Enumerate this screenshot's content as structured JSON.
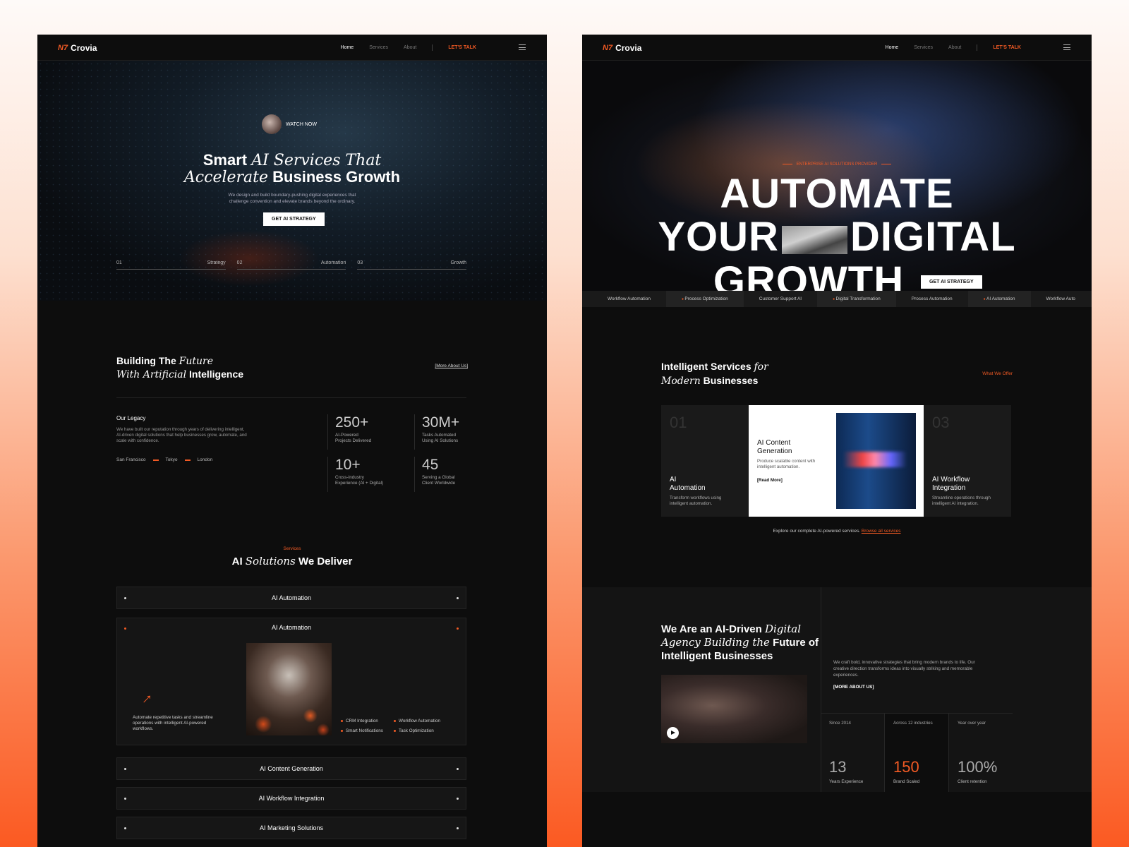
{
  "nav": {
    "logo": "Crovia",
    "logo_mark": "N7",
    "links": [
      "Home",
      "Services",
      "About"
    ],
    "cta": "LET'S TALK"
  },
  "page1": {
    "watch_label": "WATCH NOW",
    "hero": {
      "line1_a": "Smart",
      "line1_b": "AI Services That",
      "line2_a": "Accelerate",
      "line2_b": "Business Growth",
      "subtitle_1": "We design and build boundary-pushing digital experiences that",
      "subtitle_2": "challenge convention and elevate brands beyond the ordinary.",
      "button": "GET AI STRATEGY"
    },
    "steps": [
      {
        "num": "01",
        "label": "Strategy"
      },
      {
        "num": "02",
        "label": "Automation"
      },
      {
        "num": "03",
        "label": "Growth"
      }
    ],
    "about": {
      "title_a": "Building The",
      "title_b": "Future",
      "title_c": "With Artificial",
      "title_d": "Intelligence",
      "link": "[More About Us]",
      "legacy_title": "Our Legacy",
      "legacy_text": "We have built our reputation through years of delivering intelligent, AI-driven digital solutions that help businesses grow, automate, and scale with confidence.",
      "cities": [
        "San Francisco",
        "Tokyo",
        "London"
      ]
    },
    "stats": [
      {
        "num": "250+",
        "l1": "AI-Powered",
        "l2": "Projects Delivered"
      },
      {
        "num": "30M+",
        "l1": "Tasks Automated",
        "l2": "Using AI Solutions"
      },
      {
        "num": "10+",
        "l1": "Cross-Industry",
        "l2": "Experience (AI + Digital)"
      },
      {
        "num": "45",
        "l1": "Serving a Global",
        "l2": "Client Worldwide"
      }
    ],
    "services": {
      "tag": "Services",
      "title_a": "AI",
      "title_b": "Solutions",
      "title_c": "We Deliver",
      "items": [
        "AI Automation",
        "AI Automation",
        "AI Content Generation",
        "AI Workflow Integration",
        "AI Marketing Solutions"
      ],
      "open_desc": "Automate repetitive tasks and streamline operations with intelligent AI-powered workflows.",
      "features": [
        "CRM Integration",
        "Workflow Automation",
        "Smart Notifications",
        "Task Optimization"
      ]
    }
  },
  "page2": {
    "eyebrow": "ENTERPRISE AI SOLUTIONS PROVIDER",
    "hero": {
      "line1": "AUTOMATE",
      "line2_a": "YOUR",
      "line2_b": "DIGITAL",
      "line3": "GROWTH",
      "button": "GET AI STRATEGY"
    },
    "marquee": [
      "Workflow Automation",
      "Process Optimization",
      "Customer Support AI",
      "Digital Transformation",
      "Process Automation",
      "AI Automation",
      "Workflow Auto"
    ],
    "services": {
      "title_a": "Intelligent Services",
      "title_b": "for",
      "title_c": "Modern",
      "title_d": "Businesses",
      "link": "What We Offer",
      "cards": [
        {
          "num": "01",
          "title_1": "AI",
          "title_2": "Automation",
          "desc_1": "Transform workflows using",
          "desc_2": "intelligent automation."
        },
        {
          "title_1": "AI Content",
          "title_2": "Generation",
          "desc_1": "Produce scalable content with",
          "desc_2": "intelligent automation.",
          "link": "[Read More]"
        },
        {
          "num": "03",
          "title_1": "AI Workflow",
          "title_2": "Integration",
          "desc_1": "Streamline operations through",
          "desc_2": "intelligent AI integration."
        }
      ],
      "explore": "Explore our complete AI-powered services.",
      "explore_link": "Browse all services"
    },
    "about": {
      "title_a": "We Are an AI-Driven",
      "title_b": "Digital",
      "title_c": "Agency Building the",
      "title_d": "Future of",
      "title_e": "Intelligent Businesses",
      "text": "We craft bold, innovative strategies that bring modern brands to life. Our creative direction transforms ideas into visually striking and memorable experiences.",
      "link": "[MORE ABOUT US]",
      "stats": [
        {
          "label": "Since 2014",
          "num": "13",
          "sub": "Years Experience"
        },
        {
          "label": "Across 12 industries",
          "num": "150",
          "sub": "Brand Scaled"
        },
        {
          "label": "Year over year",
          "num": "100%",
          "sub": "Client retention"
        }
      ]
    }
  },
  "colors": {
    "accent": "#f25a24",
    "panel_bg": "#0d0d0d"
  }
}
